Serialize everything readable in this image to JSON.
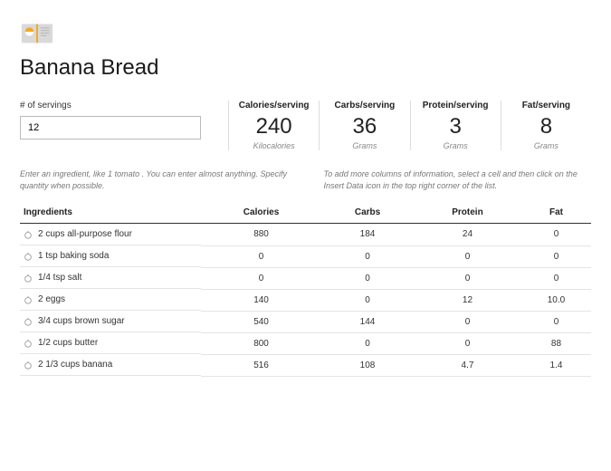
{
  "title": "Banana Bread",
  "servings": {
    "label": "# of servings",
    "value": "12"
  },
  "stats": [
    {
      "label": "Calories/serving",
      "value": "240",
      "unit": "Kilocalories"
    },
    {
      "label": "Carbs/serving",
      "value": "36",
      "unit": "Grams"
    },
    {
      "label": "Protein/serving",
      "value": "3",
      "unit": "Grams"
    },
    {
      "label": "Fat/serving",
      "value": "8",
      "unit": "Grams"
    }
  ],
  "hints": {
    "left": "Enter an ingredient, like 1 tomato . You can enter almost anything. Specify quantity when possible.",
    "right": "To add more columns of information, select a cell and then click on the Insert Data icon in the top right corner of the list."
  },
  "columns": [
    "Ingredients",
    "Calories",
    "Carbs",
    "Protein",
    "Fat"
  ],
  "rows": [
    {
      "ing": "2 cups all-purpose flour",
      "cal": "880",
      "carbs": "184",
      "pro": "24",
      "fat": "0"
    },
    {
      "ing": "1 tsp baking soda",
      "cal": "0",
      "carbs": "0",
      "pro": "0",
      "fat": "0"
    },
    {
      "ing": "1/4 tsp salt",
      "cal": "0",
      "carbs": "0",
      "pro": "0",
      "fat": "0"
    },
    {
      "ing": "2 eggs",
      "cal": "140",
      "carbs": "0",
      "pro": "12",
      "fat": "10.0"
    },
    {
      "ing": "3/4 cups brown sugar",
      "cal": "540",
      "carbs": "144",
      "pro": "0",
      "fat": "0"
    },
    {
      "ing": "1/2 cups butter",
      "cal": "800",
      "carbs": "0",
      "pro": "0",
      "fat": "88"
    },
    {
      "ing": "2 1/3 cups banana",
      "cal": "516",
      "carbs": "108",
      "pro": "4.7",
      "fat": "1.4"
    }
  ]
}
